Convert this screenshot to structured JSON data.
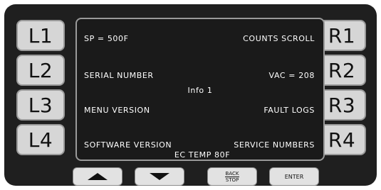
{
  "left_keys": [
    "L1",
    "L2",
    "L3",
    "L4"
  ],
  "right_keys": [
    "R1",
    "R2",
    "R3",
    "R4"
  ],
  "screen": {
    "row1_left": "SP = 500F",
    "row1_right": "COUNTS SCROLL",
    "row2_left": "SERIAL NUMBER",
    "row2_right": "VAC = 208",
    "center_title": "Info 1",
    "row3_left": "MENU VERSION",
    "row3_right": "FAULT LOGS",
    "row4_left": "SOFTWARE VERSION",
    "row4_right": "SERVICE NUMBERS",
    "bottom_center": "EC TEMP 80F"
  },
  "bottom_buttons": {
    "up_icon": "arrow-up-icon",
    "down_icon": "arrow-down-icon",
    "back_label": "BACK",
    "stop_label": "STOP",
    "enter_label": "ENTER"
  }
}
